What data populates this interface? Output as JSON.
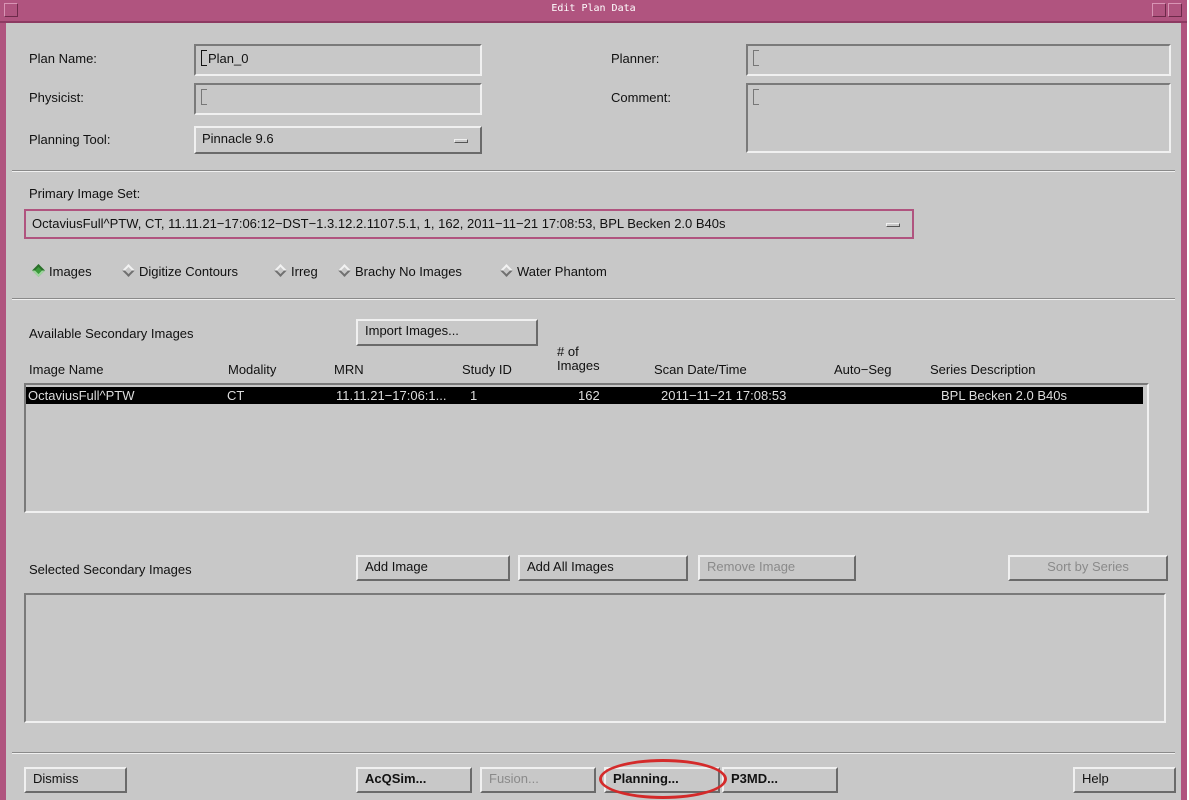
{
  "window": {
    "title": "Edit Plan Data"
  },
  "plan": {
    "plan_name_label": "Plan Name:",
    "plan_name_value": "Plan_0",
    "physicist_label": "Physicist:",
    "physicist_value": "",
    "planning_tool_label": "Planning Tool:",
    "planning_tool_value": "Pinnacle 9.6",
    "planner_label": "Planner:",
    "planner_value": "",
    "comment_label": "Comment:",
    "comment_value": ""
  },
  "primary": {
    "label": "Primary Image Set:",
    "value": "OctaviusFull^PTW, CT, 11.11.21−17:06:12−DST−1.3.12.2.1107.5.1, 1, 162, 2011−11−21 17:08:53, BPL Becken 2.0 B40s"
  },
  "modes": {
    "selected": "Images",
    "items": [
      "Images",
      "Digitize Contours",
      "Irreg",
      "Brachy No Images",
      "Water Phantom"
    ]
  },
  "available": {
    "label": "Available Secondary Images",
    "import_button": "Import Images...",
    "columns": [
      "Image Name",
      "Modality",
      "MRN",
      "Study ID",
      "# of\nImages",
      "Scan Date/Time",
      "Auto−Seg",
      "Series Description"
    ],
    "rows": [
      {
        "name": "OctaviusFull^PTW",
        "modality": "CT",
        "mrn": "11.11.21−17:06:1...",
        "study_id": "1",
        "num_images": "162",
        "scan_date": "2011−11−21 17:08:53",
        "auto_seg": "",
        "series": "BPL Becken 2.0 B40s"
      }
    ]
  },
  "selected": {
    "label": "Selected Secondary Images",
    "add_image": "Add Image",
    "add_all": "Add All Images",
    "remove_image": "Remove Image",
    "sort_by_series": "Sort by Series"
  },
  "footer": {
    "dismiss": "Dismiss",
    "acqsim": "AcQSim...",
    "fusion": "Fusion...",
    "planning": "Planning...",
    "p3md": "P3MD...",
    "help": "Help"
  },
  "colors": {
    "title_bar": "#b0547f",
    "panel": "#c8c8c8",
    "highlight_annotation": "#d42a2a",
    "radio_selected": "#3a9a3a"
  }
}
